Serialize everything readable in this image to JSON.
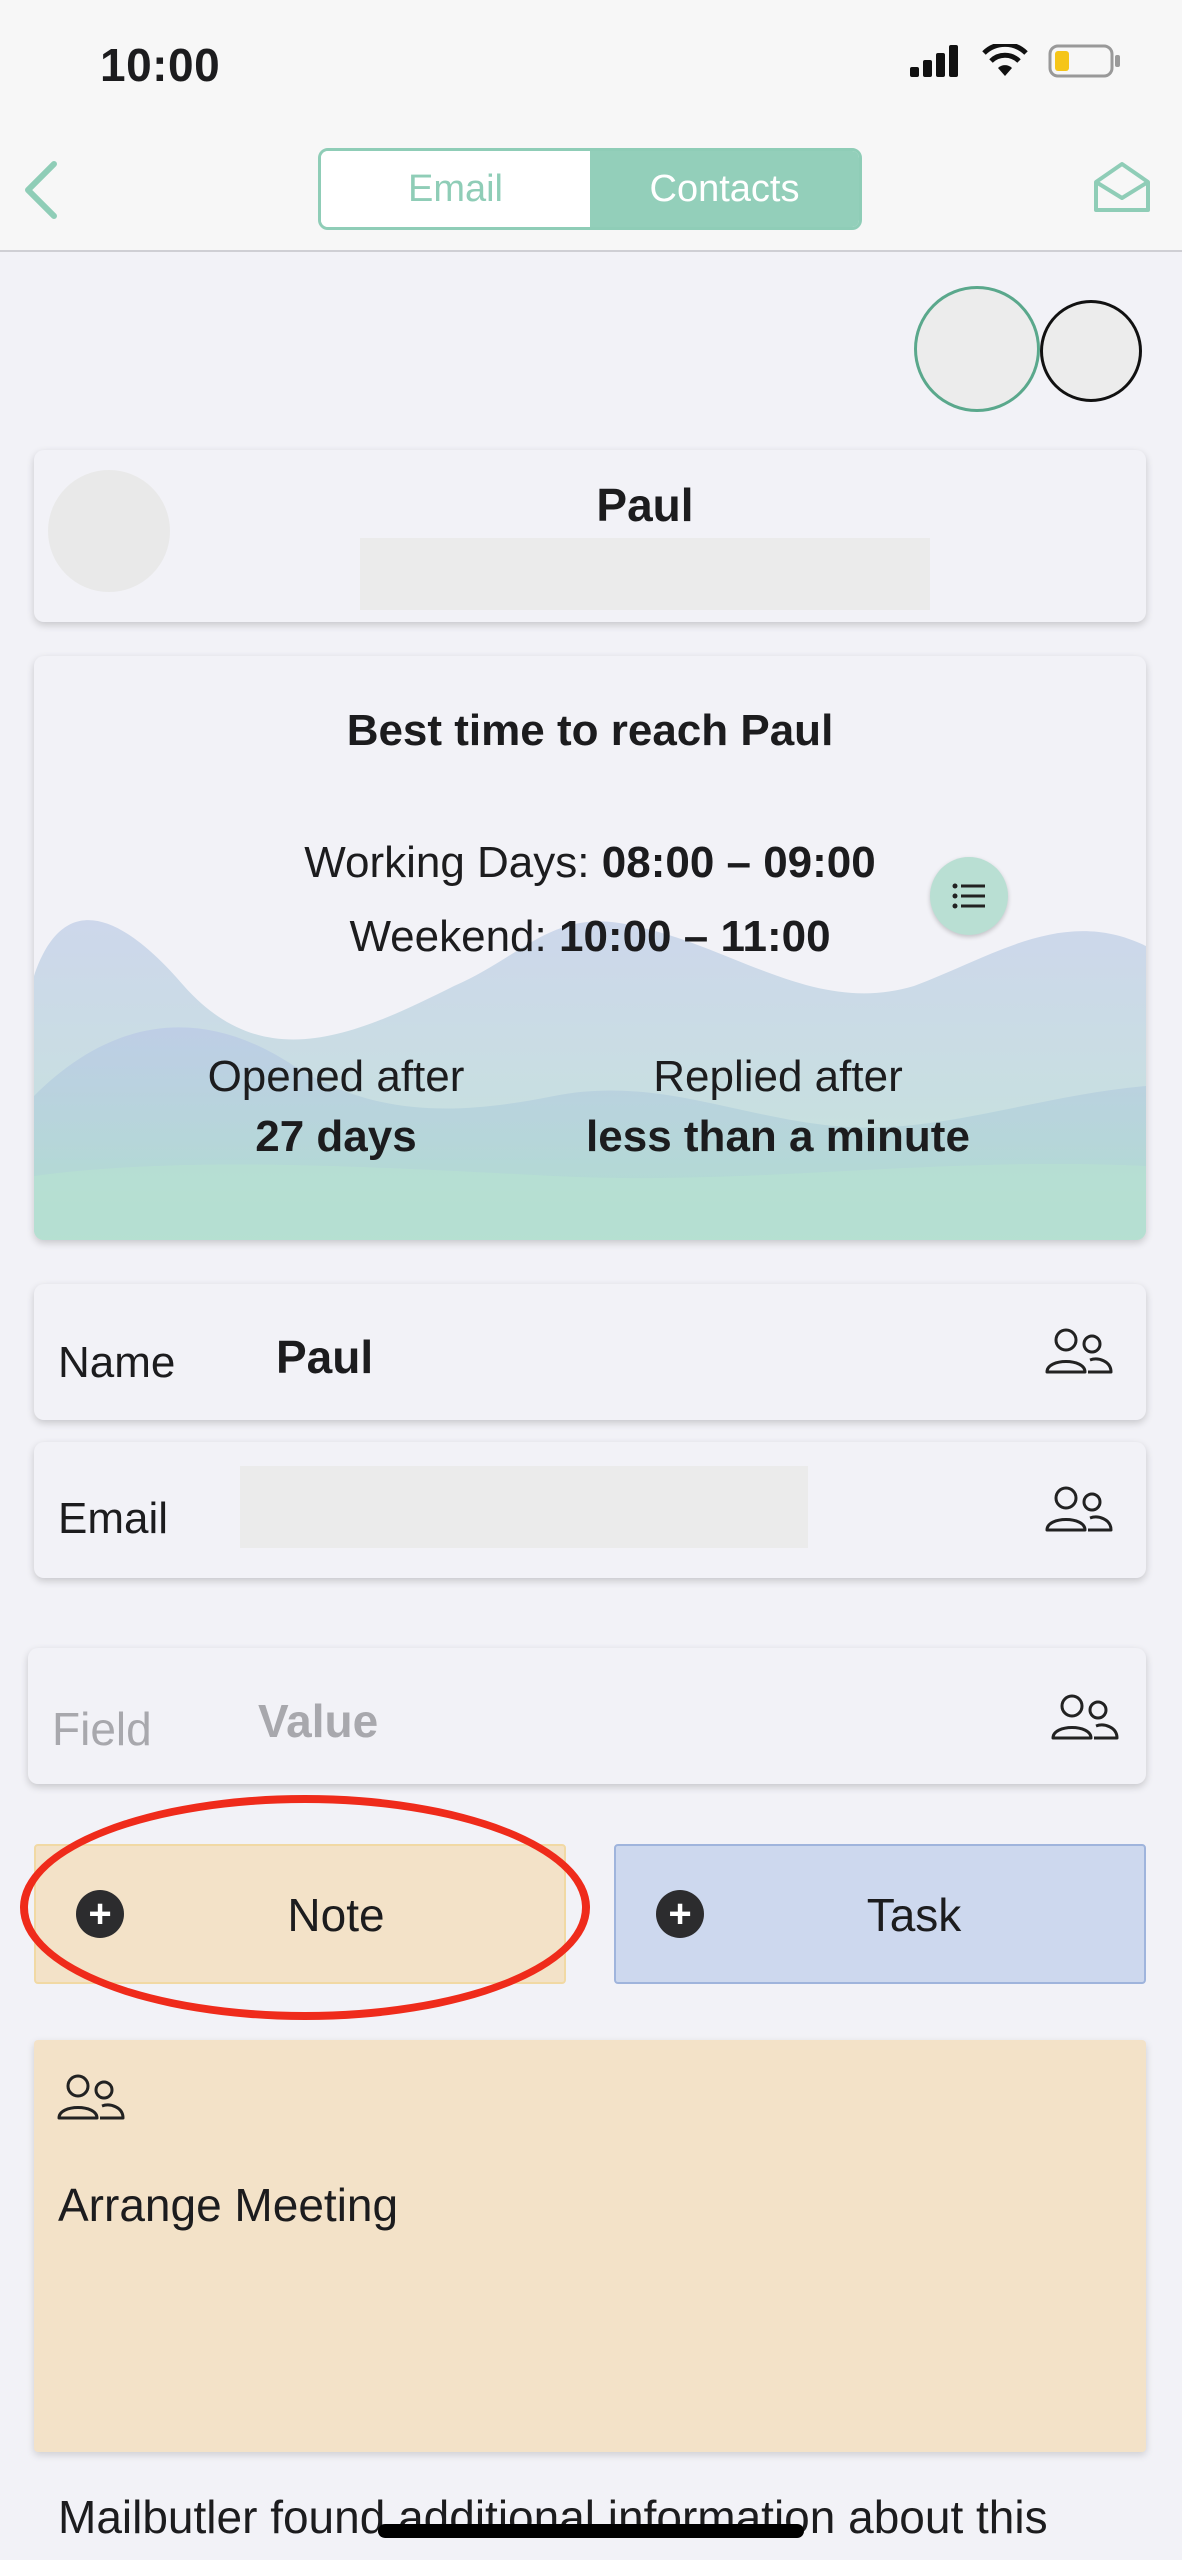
{
  "status_bar": {
    "time": "10:00"
  },
  "nav": {
    "tabs": [
      {
        "label": "Email",
        "active": false
      },
      {
        "label": "Contacts",
        "active": true
      }
    ],
    "accent_color": "#8fcdb7"
  },
  "contact": {
    "name": "Paul"
  },
  "best_time": {
    "title": "Best time to reach Paul",
    "working_days_label": "Working Days:",
    "working_days_value": "08:00 – 09:00",
    "weekend_label": "Weekend:",
    "weekend_value": "10:00 – 11:00",
    "opened_label": "Opened after",
    "opened_value": "27 days",
    "replied_label": "Replied after",
    "replied_value": "less than a minute"
  },
  "fields": {
    "name_label": "Name",
    "name_value": "Paul",
    "email_label": "Email",
    "custom_field_placeholder": "Field",
    "custom_value_placeholder": "Value"
  },
  "actions": {
    "note_label": "Note",
    "task_label": "Task",
    "note_color": "#f3e2c8",
    "task_color": "#cdd8ee"
  },
  "note": {
    "text": "Arrange Meeting"
  },
  "footer": {
    "text": "Mailbutler found additional information about this"
  }
}
